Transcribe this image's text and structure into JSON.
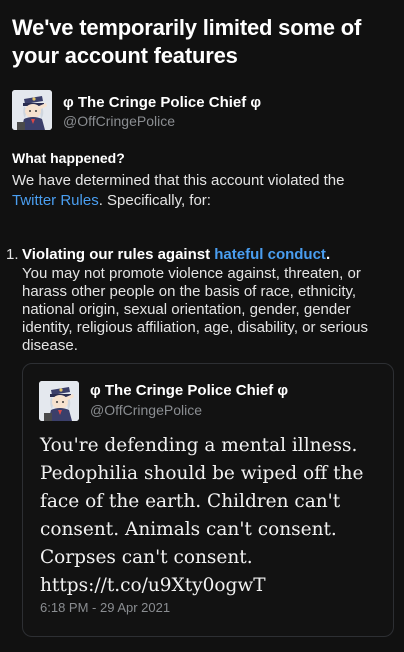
{
  "headline": "We've temporarily limited some of your account features",
  "account": {
    "name": "φ The Cringe Police Chief φ",
    "handle": "@OffCringePolice"
  },
  "what_happened": {
    "title": "What happened?",
    "body_prefix": "We have determined that this account violated the ",
    "rules_link": "Twitter Rules",
    "body_suffix": ". Specifically, for:"
  },
  "violation": {
    "number": "1.",
    "title_prefix": "Violating our rules against ",
    "title_link": "hateful conduct",
    "title_suffix": ".",
    "description": "You may not promote violence against, threaten, or harass other people on the basis of race, ethnicity, national origin, sexual orientation, gender, gender identity, religious affiliation, age, disability, or serious disease."
  },
  "tweet": {
    "name": "φ The Cringe Police Chief φ",
    "handle": "@OffCringePolice",
    "text": "You're defending a mental illness. Pedophilia should be wiped off the face of the earth. Children can't consent. Animals can't consent. Corpses can't consent. https://t.co/u9Xty0ogwT",
    "timestamp": "6:18 PM - 29 Apr 2021"
  },
  "colors": {
    "background": "#111111",
    "link": "#4a9ef0",
    "secondary_text": "#8a8d91",
    "card_border": "#2d2f33"
  },
  "icons": {
    "avatar": "cartoon-police-officer-saluting"
  }
}
